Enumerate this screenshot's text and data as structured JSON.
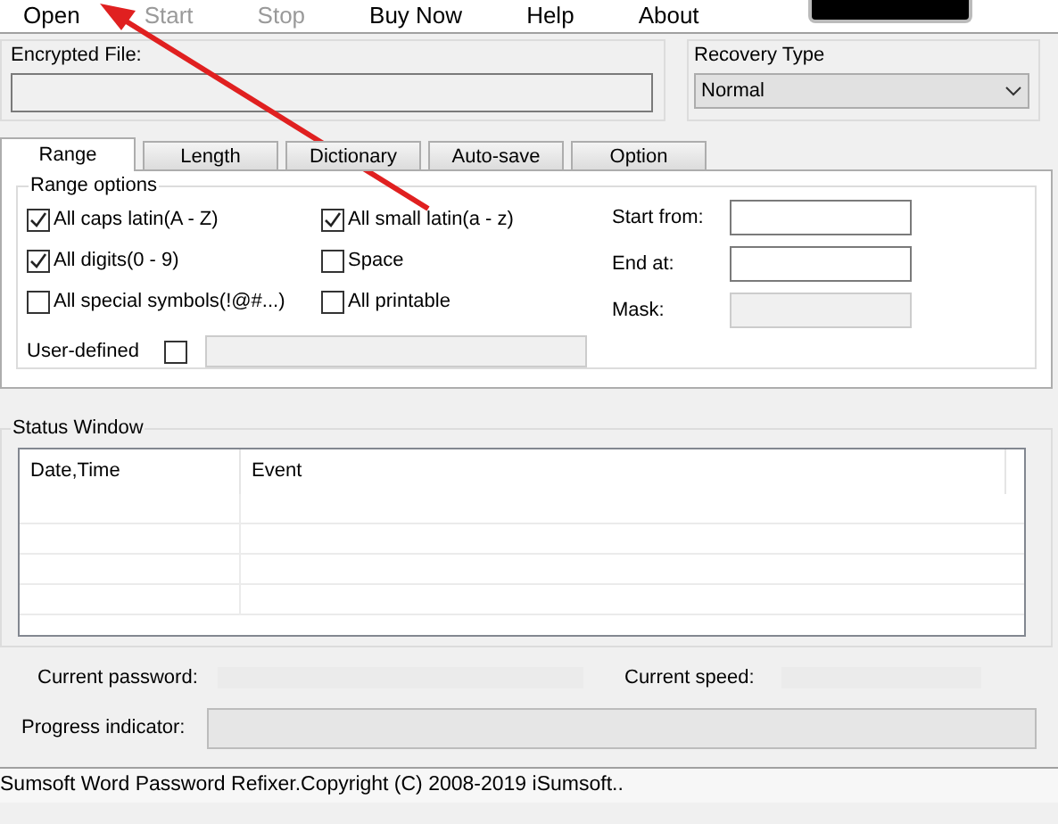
{
  "menu": [
    {
      "label": "Open",
      "disabled": false
    },
    {
      "label": "Start",
      "disabled": true
    },
    {
      "label": "Stop",
      "disabled": true
    },
    {
      "label": "Buy Now",
      "disabled": false
    },
    {
      "label": "Help",
      "disabled": false
    },
    {
      "label": "About",
      "disabled": false
    }
  ],
  "encrypted_file": {
    "label": "Encrypted File:"
  },
  "recovery_type": {
    "label": "Recovery Type",
    "value": "Normal"
  },
  "tabs": [
    {
      "label": "Range",
      "selected": true
    },
    {
      "label": "Length",
      "selected": false
    },
    {
      "label": "Dictionary",
      "selected": false
    },
    {
      "label": "Auto-save",
      "selected": false
    },
    {
      "label": "Option",
      "selected": false
    }
  ],
  "range_options": {
    "title": "Range options",
    "checkboxes": [
      {
        "label": "All caps latin(A - Z)",
        "checked": true
      },
      {
        "label": "All small latin(a - z)",
        "checked": true
      },
      {
        "label": "All digits(0 - 9)",
        "checked": true
      },
      {
        "label": "Space",
        "checked": false
      },
      {
        "label": "All special symbols(!@#...)",
        "checked": false
      },
      {
        "label": "All printable",
        "checked": false
      }
    ],
    "user_defined": {
      "label": "User-defined",
      "checked": false
    },
    "fields": [
      {
        "label": "Start from:",
        "disabled": false
      },
      {
        "label": "End at:",
        "disabled": false
      },
      {
        "label": "Mask:",
        "disabled": true
      }
    ]
  },
  "status_window": {
    "title": "Status Window",
    "columns": [
      "Date,Time",
      "Event"
    ]
  },
  "current_password": {
    "label": "Current password:"
  },
  "current_speed": {
    "label": "Current speed:"
  },
  "progress": {
    "label": "Progress indicator:",
    "level": 0
  },
  "status_bar": "Sumsoft Word Password Refixer.Copyright (C) 2008-2019 iSumsoft.."
}
